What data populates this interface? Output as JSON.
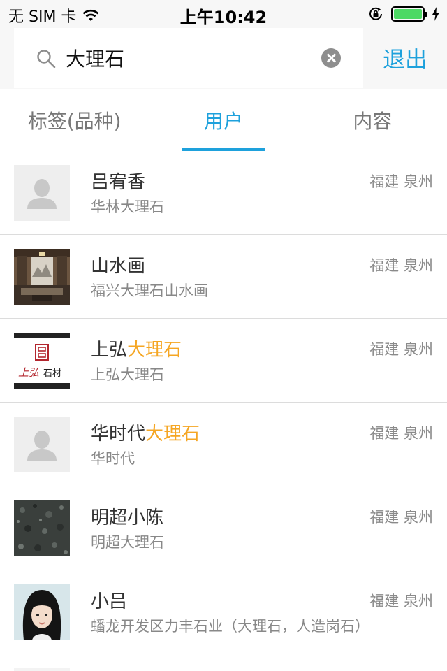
{
  "status_bar": {
    "carrier": "无 SIM 卡",
    "time": "上午10:42"
  },
  "search": {
    "query": "大理石",
    "exit_label": "退出"
  },
  "tabs": [
    {
      "label": "标签(品种)",
      "active": false
    },
    {
      "label": "用户",
      "active": true
    },
    {
      "label": "内容",
      "active": false
    }
  ],
  "accent_color": "#1ea1dc",
  "highlight_color": "#f5a623",
  "users": [
    {
      "name": "吕宥香",
      "name_highlight": "",
      "subtitle": "华林大理石",
      "location": "福建 泉州",
      "avatar": "placeholder"
    },
    {
      "name": "山水画",
      "name_highlight": "",
      "subtitle": "福兴大理石山水画",
      "location": "福建 泉州",
      "avatar": "interior-photo"
    },
    {
      "name": "上弘",
      "name_highlight": "大理石",
      "subtitle": "上弘大理石",
      "location": "福建 泉州",
      "avatar": "shanghong-logo",
      "logo_text": "上弘石材"
    },
    {
      "name": "华时代",
      "name_highlight": "大理石",
      "subtitle": "华时代",
      "location": "福建 泉州",
      "avatar": "placeholder"
    },
    {
      "name": "明超小陈",
      "name_highlight": "",
      "subtitle": "明超大理石",
      "location": "福建 泉州",
      "avatar": "granite-texture"
    },
    {
      "name": "小吕",
      "name_highlight": "",
      "subtitle": "蟠龙开发区力丰石业（大理石，人造岗石）",
      "location": "福建 泉州",
      "avatar": "portrait-photo"
    }
  ]
}
